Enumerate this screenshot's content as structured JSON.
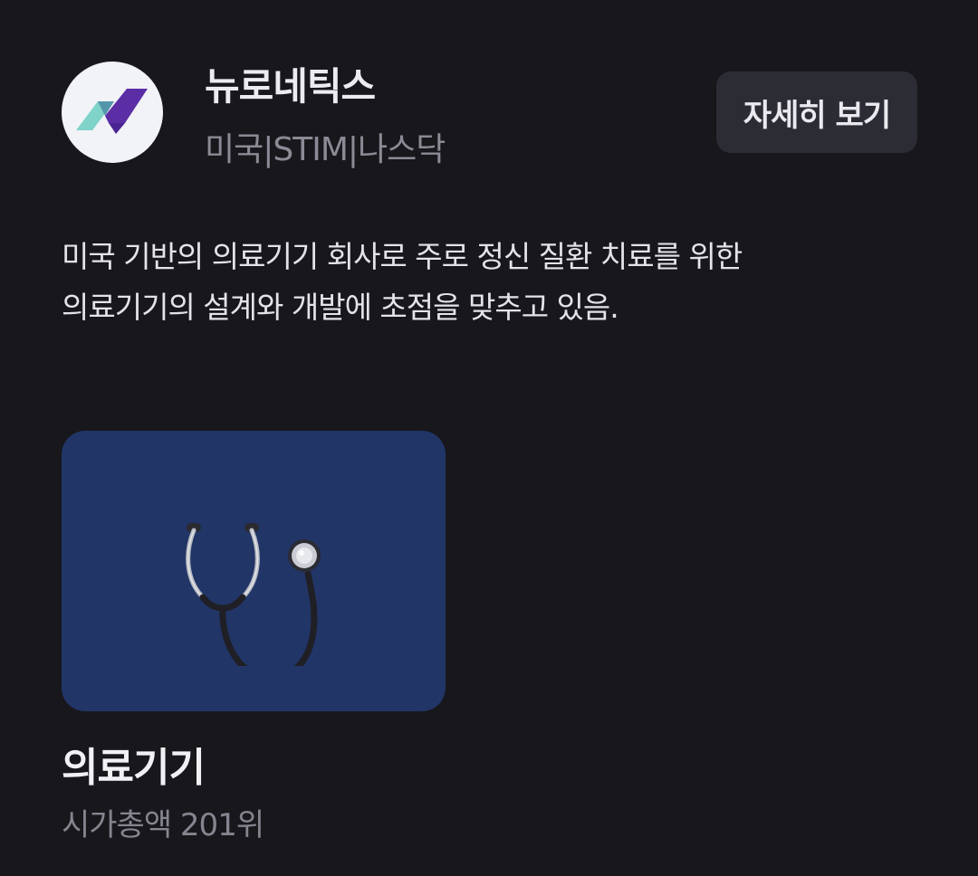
{
  "company": {
    "name": "뉴로네틱스",
    "meta": "미국|STIM|나스닥",
    "logo_icon": "neuronetics-logo",
    "logo_colors": {
      "teal": "#7fd3c8",
      "purple": "#5b2ea6"
    }
  },
  "header": {
    "detail_button_label": "자세히 보기"
  },
  "description": {
    "lines": [
      "미국 기반의 의료기기 회사로 주로 정신 질환 치료를 위한",
      "의료기기의 설계와 개발에 초점을 맞추고 있음."
    ]
  },
  "category": {
    "icon": "stethoscope-icon",
    "title": "의료기기",
    "rank": "시가총액 201위",
    "card_color": "#213567"
  },
  "colors": {
    "background": "#17171c",
    "button_bg": "#2c2c35",
    "primary_text": "#ececf0",
    "secondary_text": "#8b8b95"
  }
}
